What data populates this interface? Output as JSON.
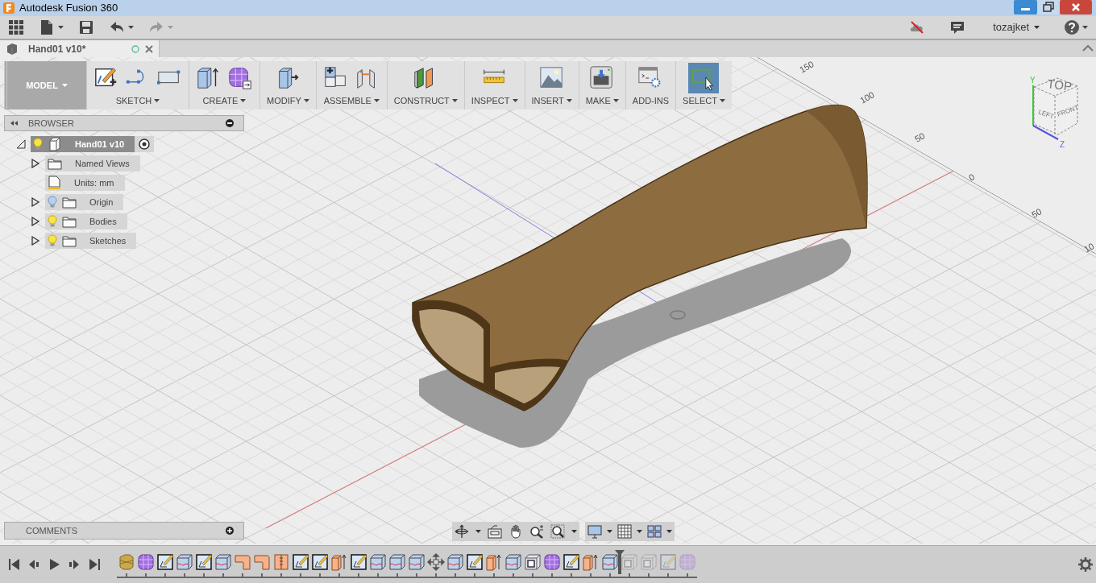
{
  "window": {
    "title": "Autodesk Fusion 360"
  },
  "quick_access": [
    {
      "kind": "apps",
      "menu": false,
      "disabled": false
    },
    {
      "kind": "file",
      "menu": true,
      "disabled": false
    },
    {
      "kind": "save",
      "menu": false,
      "disabled": false
    },
    {
      "kind": "undo",
      "menu": true,
      "disabled": false
    },
    {
      "kind": "redo",
      "menu": true,
      "disabled": true
    }
  ],
  "account": {
    "user": "tozajket"
  },
  "document_tab": {
    "title": "Hand01 v10*"
  },
  "toolbar": {
    "workspace": "MODEL",
    "groups": [
      {
        "label": "SKETCH",
        "menu": true,
        "selected": false,
        "tools": [
          {
            "kind": "sketch"
          },
          {
            "kind": "arc"
          },
          {
            "kind": "rectangle"
          }
        ]
      },
      {
        "label": "CREATE",
        "menu": true,
        "selected": false,
        "tools": [
          {
            "kind": "extrude"
          },
          {
            "kind": "form"
          }
        ]
      },
      {
        "label": "MODIFY",
        "menu": true,
        "selected": false,
        "tools": [
          {
            "kind": "presspull"
          }
        ]
      },
      {
        "label": "ASSEMBLE",
        "menu": true,
        "selected": false,
        "tools": [
          {
            "kind": "component"
          },
          {
            "kind": "joint"
          }
        ]
      },
      {
        "label": "CONSTRUCT",
        "menu": true,
        "selected": false,
        "tools": [
          {
            "kind": "plane"
          }
        ]
      },
      {
        "label": "INSPECT",
        "menu": true,
        "selected": false,
        "tools": [
          {
            "kind": "measure"
          }
        ]
      },
      {
        "label": "INSERT",
        "menu": true,
        "selected": false,
        "tools": [
          {
            "kind": "canvas"
          }
        ]
      },
      {
        "label": "MAKE",
        "menu": true,
        "selected": false,
        "tools": [
          {
            "kind": "print"
          }
        ]
      },
      {
        "label": "ADD-INS",
        "menu": false,
        "selected": false,
        "tools": [
          {
            "kind": "scripts"
          }
        ]
      },
      {
        "label": "SELECT",
        "menu": true,
        "selected": true,
        "tools": [
          {
            "kind": "select"
          }
        ]
      }
    ]
  },
  "browser": {
    "title": "BROWSER",
    "tree": [
      {
        "label": "Hand01 v10",
        "kind": "component",
        "visible": true,
        "expanded": true,
        "active": true,
        "children": [
          {
            "label": "Named Views",
            "kind": "folder",
            "expanded": false
          },
          {
            "label": "Units: mm",
            "kind": "units"
          },
          {
            "label": "Origin",
            "kind": "folder",
            "visible": false,
            "expanded": false
          },
          {
            "label": "Bodies",
            "kind": "folder",
            "visible": true,
            "expanded": false
          },
          {
            "label": "Sketches",
            "kind": "folder",
            "visible": true,
            "expanded": false
          }
        ]
      }
    ]
  },
  "viewport": {
    "grid_labels": [
      "150",
      "100",
      "50",
      "0",
      "50",
      "10"
    ],
    "view_cube": {
      "faces": [
        "TOP",
        "LEFT",
        "FRONT"
      ],
      "axes": [
        "Y",
        "Z"
      ]
    }
  },
  "comments": {
    "title": "COMMENTS"
  },
  "timeline": {
    "items": [
      {
        "kind": "body",
        "rolled_back": false
      },
      {
        "kind": "form",
        "rolled_back": false
      },
      {
        "kind": "sketch",
        "rolled_back": false
      },
      {
        "kind": "surface",
        "rolled_back": false
      },
      {
        "kind": "sketch",
        "rolled_back": false
      },
      {
        "kind": "surface",
        "rolled_back": false
      },
      {
        "kind": "fillet",
        "rolled_back": false
      },
      {
        "kind": "fillet",
        "rolled_back": false
      },
      {
        "kind": "split",
        "rolled_back": false
      },
      {
        "kind": "sketch",
        "rolled_back": false
      },
      {
        "kind": "sketch",
        "rolled_back": false
      },
      {
        "kind": "extrude",
        "rolled_back": false
      },
      {
        "kind": "sketch",
        "rolled_back": false
      },
      {
        "kind": "surface",
        "rolled_back": false
      },
      {
        "kind": "surface",
        "rolled_back": false
      },
      {
        "kind": "surface",
        "rolled_back": false
      },
      {
        "kind": "move",
        "rolled_back": false
      },
      {
        "kind": "surface",
        "rolled_back": false
      },
      {
        "kind": "sketch",
        "rolled_back": false
      },
      {
        "kind": "extrude",
        "rolled_back": false
      },
      {
        "kind": "surface",
        "rolled_back": false
      },
      {
        "kind": "box",
        "rolled_back": false
      },
      {
        "kind": "form",
        "rolled_back": false
      },
      {
        "kind": "sketch",
        "rolled_back": false
      },
      {
        "kind": "extrude",
        "rolled_back": false
      },
      {
        "kind": "surface",
        "rolled_back": false
      },
      {
        "kind": "box",
        "rolled_back": true
      },
      {
        "kind": "box",
        "rolled_back": true
      },
      {
        "kind": "sketch",
        "rolled_back": true
      },
      {
        "kind": "form",
        "rolled_back": true
      }
    ]
  }
}
